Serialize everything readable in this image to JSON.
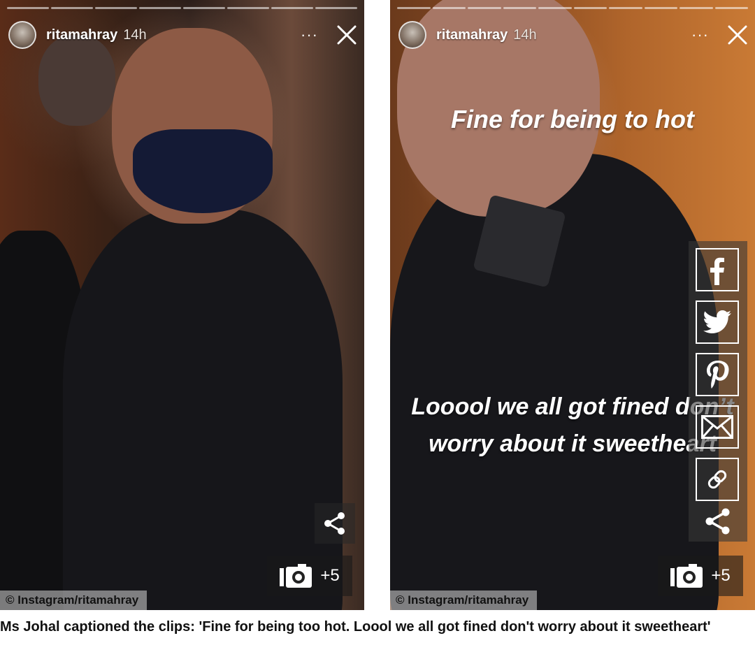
{
  "stories": [
    {
      "username": "ritamahray",
      "time_ago": "14h",
      "more_label": "···",
      "credit": "© Instagram/ritamahray",
      "gallery_count": "+5"
    },
    {
      "username": "ritamahray",
      "time_ago": "14h",
      "more_label": "···",
      "text_top": "Fine for being to hot",
      "text_bottom": "Looool we all got fined don’t worry about it sweetheart",
      "credit": "© Instagram/ritamahray",
      "gallery_count": "+5"
    }
  ],
  "share_rail": {
    "items": [
      "facebook-icon",
      "twitter-icon",
      "pinterest-icon",
      "email-icon",
      "link-icon",
      "share-icon"
    ]
  },
  "article": {
    "caption": "Ms Johal captioned the clips: 'Fine for being too hot. Loool we all got fined don't worry about it sweetheart'"
  },
  "colors": {
    "rail_background": "#373737",
    "caption_text": "#111111",
    "overlay_text": "#ffffff"
  }
}
